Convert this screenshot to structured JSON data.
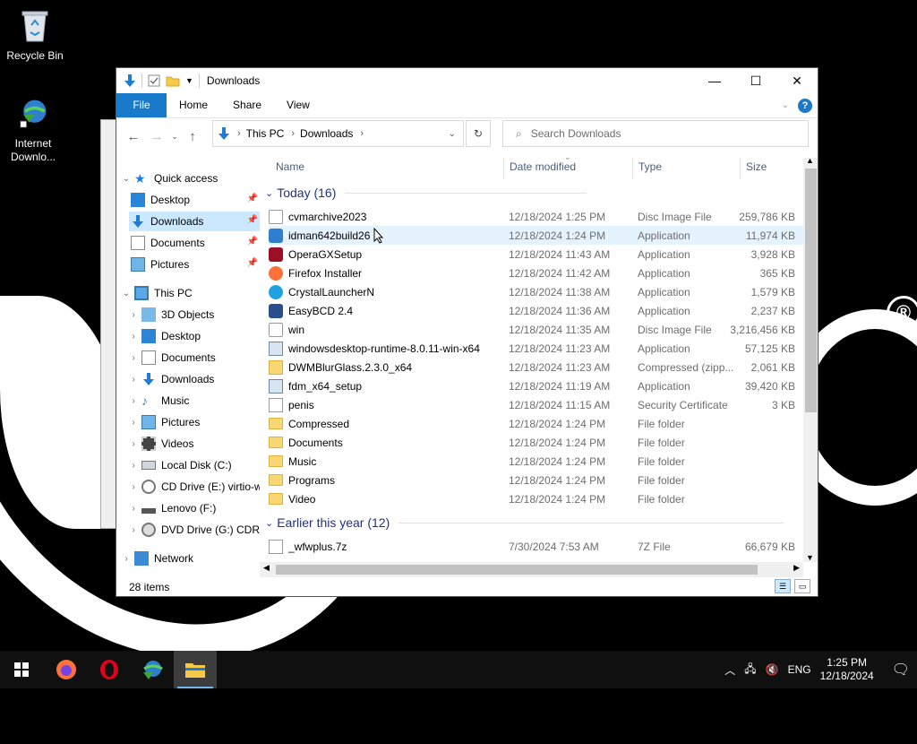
{
  "desktop": {
    "icons": [
      {
        "label": "Recycle Bin"
      },
      {
        "label": "Internet Downlo..."
      }
    ]
  },
  "window": {
    "title": "Downloads",
    "tabs": {
      "file": "File",
      "home": "Home",
      "share": "Share",
      "view": "View"
    },
    "help": "?",
    "address": {
      "root": "This PC",
      "folder": "Downloads"
    },
    "search_placeholder": "Search Downloads",
    "status": "28 items"
  },
  "sidebar": {
    "quick_access": "Quick access",
    "qa_items": [
      "Desktop",
      "Downloads",
      "Documents",
      "Pictures"
    ],
    "this_pc": "This PC",
    "pc_items": [
      "3D Objects",
      "Desktop",
      "Documents",
      "Downloads",
      "Music",
      "Pictures",
      "Videos",
      "Local Disk (C:)",
      "CD Drive (E:) virtio-w",
      "Lenovo (F:)",
      "DVD Drive (G:) CDR("
    ],
    "network": "Network"
  },
  "columns": {
    "name": "Name",
    "date": "Date modified",
    "type": "Type",
    "size": "Size"
  },
  "groups": {
    "today": "Today (16)",
    "earlier": "Earlier this year (12)"
  },
  "files_today": [
    {
      "name": "cvmarchive2023",
      "date": "12/18/2024 1:25 PM",
      "type": "Disc Image File",
      "size": "259,786 KB",
      "icon": "disc-image-icon"
    },
    {
      "name": "idman642build26",
      "date": "12/18/2024 1:24 PM",
      "type": "Application",
      "size": "11,974 KB",
      "icon": "idm-icon"
    },
    {
      "name": "OperaGXSetup",
      "date": "12/18/2024 11:43 AM",
      "type": "Application",
      "size": "3,928 KB",
      "icon": "opera-gx-icon"
    },
    {
      "name": "Firefox Installer",
      "date": "12/18/2024 11:42 AM",
      "type": "Application",
      "size": "365 KB",
      "icon": "firefox-icon"
    },
    {
      "name": "CrystalLauncherN",
      "date": "12/18/2024 11:38 AM",
      "type": "Application",
      "size": "1,579 KB",
      "icon": "crystal-icon"
    },
    {
      "name": "EasyBCD 2.4",
      "date": "12/18/2024 11:36 AM",
      "type": "Application",
      "size": "2,237 KB",
      "icon": "easybcd-icon"
    },
    {
      "name": "win",
      "date": "12/18/2024 11:35 AM",
      "type": "Disc Image File",
      "size": "3,216,456 KB",
      "icon": "disc-image-icon"
    },
    {
      "name": "windowsdesktop-runtime-8.0.11-win-x64",
      "date": "12/18/2024 11:23 AM",
      "type": "Application",
      "size": "57,125 KB",
      "icon": "installer-icon"
    },
    {
      "name": "DWMBlurGlass.2.3.0_x64",
      "date": "12/18/2024 11:23 AM",
      "type": "Compressed (zipp...",
      "size": "2,061 KB",
      "icon": "zip-folder-icon"
    },
    {
      "name": "fdm_x64_setup",
      "date": "12/18/2024 11:19 AM",
      "type": "Application",
      "size": "39,420 KB",
      "icon": "installer-icon"
    },
    {
      "name": "penis",
      "date": "12/18/2024 11:15 AM",
      "type": "Security Certificate",
      "size": "3 KB",
      "icon": "certificate-icon"
    },
    {
      "name": "Compressed",
      "date": "12/18/2024 1:24 PM",
      "type": "File folder",
      "size": "",
      "icon": "folder-icon"
    },
    {
      "name": "Documents",
      "date": "12/18/2024 1:24 PM",
      "type": "File folder",
      "size": "",
      "icon": "folder-icon"
    },
    {
      "name": "Music",
      "date": "12/18/2024 1:24 PM",
      "type": "File folder",
      "size": "",
      "icon": "folder-icon"
    },
    {
      "name": "Programs",
      "date": "12/18/2024 1:24 PM",
      "type": "File folder",
      "size": "",
      "icon": "folder-icon"
    },
    {
      "name": "Video",
      "date": "12/18/2024 1:24 PM",
      "type": "File folder",
      "size": "",
      "icon": "folder-icon"
    }
  ],
  "files_earlier": [
    {
      "name": "_wfwplus.7z",
      "date": "7/30/2024 7:53 AM",
      "type": "7Z File",
      "size": "66,679 KB",
      "icon": "file-icon"
    }
  ],
  "taskbar": {
    "lang": "ENG",
    "time": "1:25 PM",
    "date": "12/18/2024"
  },
  "colors": {
    "accent": "#1979ca",
    "selection": "#cce8ff",
    "hover": "#e5f3ff",
    "group": "#1e3287"
  }
}
